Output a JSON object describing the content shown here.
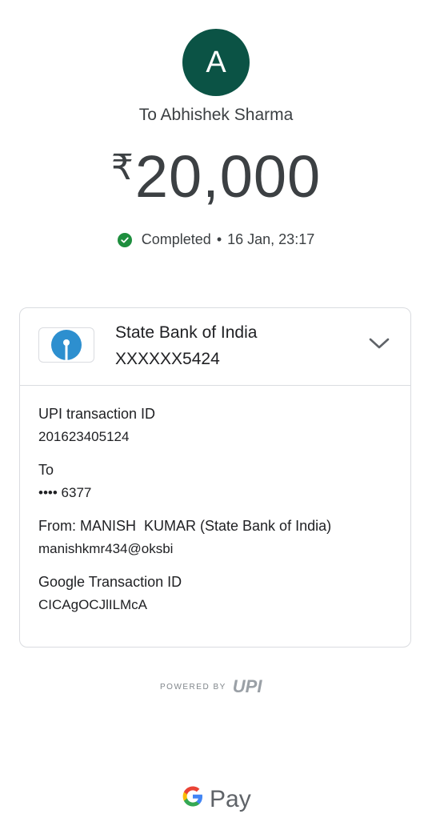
{
  "recipient": {
    "avatar_letter": "A",
    "label": "To Abhishek Sharma"
  },
  "payment": {
    "currency_symbol": "₹",
    "amount": "20,000",
    "status": "Completed",
    "separator": "•",
    "datetime": "16 Jan, 23:17"
  },
  "bank": {
    "name": "State Bank of India",
    "account": "XXXXXX5424"
  },
  "details": [
    {
      "label": "UPI transaction ID",
      "value": "201623405124"
    },
    {
      "label": "To",
      "value": "•••• 6377"
    },
    {
      "label": "From: MANISH  KUMAR (State Bank of India)",
      "value": "manishkmr434@oksbi"
    },
    {
      "label": "Google Transaction ID",
      "value": "CICAgOCJlILMcA"
    }
  ],
  "footer": {
    "powered_by": "POWERED BY",
    "upi": "UPI",
    "g": "G",
    "pay": "Pay"
  },
  "colors": {
    "avatar_bg": "#0b5345",
    "success": "#1e8e3e",
    "sbi_blue": "#2d8fcf"
  }
}
